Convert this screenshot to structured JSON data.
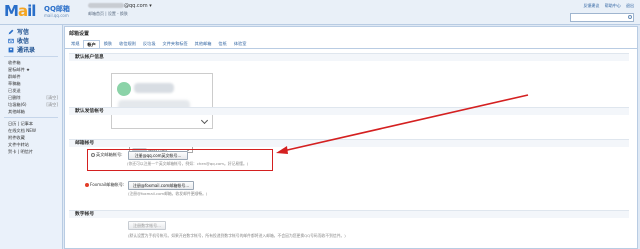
{
  "header": {
    "logo_text": "M",
    "logo_o": "a",
    "logo_tail": "il",
    "brand_cn": "QQ邮箱",
    "brand_sub": "mail.qq.com",
    "email_suffix": "@qq.com",
    "account_links": "邮箱首页 | 设置 - 换肤",
    "top_links": [
      "反馈建议",
      "帮助中心",
      "退出"
    ]
  },
  "sidebar": {
    "primary": [
      {
        "label": "写信",
        "icon": "pencil-icon"
      },
      {
        "label": "收信",
        "icon": "inbox-icon"
      },
      {
        "label": "通讯录",
        "icon": "contacts-icon"
      }
    ],
    "folders": [
      {
        "label": "收件箱",
        "count": ""
      },
      {
        "label": "星标邮件 ★",
        "count": ""
      },
      {
        "label": "群邮件",
        "count": ""
      },
      {
        "label": "草稿箱",
        "count": ""
      },
      {
        "label": "已发送",
        "count": ""
      },
      {
        "label": "已删除",
        "count": "[清空]"
      },
      {
        "label": "垃圾箱(6)",
        "count": "[清空]"
      },
      {
        "label": "其他邮箱",
        "count": ""
      }
    ],
    "extras": [
      {
        "label": "日历 | 记事本",
        "count": ""
      },
      {
        "label": "在线文档 NEW",
        "count": ""
      },
      {
        "label": "附件收藏",
        "count": ""
      },
      {
        "label": "文件中转站",
        "count": ""
      },
      {
        "label": "贺卡 | 明信片",
        "count": ""
      }
    ]
  },
  "main": {
    "title": "邮箱设置",
    "tabs": [
      "常规",
      "帐户",
      "换肤",
      "收信规则",
      "反垃圾",
      "文件夹和标签",
      "其他邮箱",
      "信纸",
      "体验室"
    ],
    "active_tab_index": 1,
    "sections": {
      "default_info": "默认帐户信息",
      "default_sender": "默认发信帐号",
      "email_accounts": "邮箱帐号",
      "digital_account": "数字帐号"
    },
    "default_sender_value": "@qq.com",
    "english_account": {
      "label": "英文邮箱帐号:",
      "button": "注册@qq.com英文帐号...",
      "note": "(你还可以注册一个英文邮箱帐号，例如：chen@qq.com。好记易懂。)"
    },
    "foxmail_account": {
      "label": "Foxmail邮箱帐号:",
      "button": "注册@foxmail.com邮箱帐号...",
      "note": "(注册@foxmail.com邮箱，收发邮件更顺畅。)"
    },
    "digital_account": {
      "button": "注册数字帐号...",
      "note": "(默认设置为手机号帐号。如果开启数字帐号，所有投递到数字帐号的邮件都将进入邮箱，不会因为您更换QQ号码而收不到信件。)"
    }
  },
  "colors": {
    "accent": "#2a6fc9",
    "highlight": "#d42020",
    "arrow": "#d42020"
  }
}
